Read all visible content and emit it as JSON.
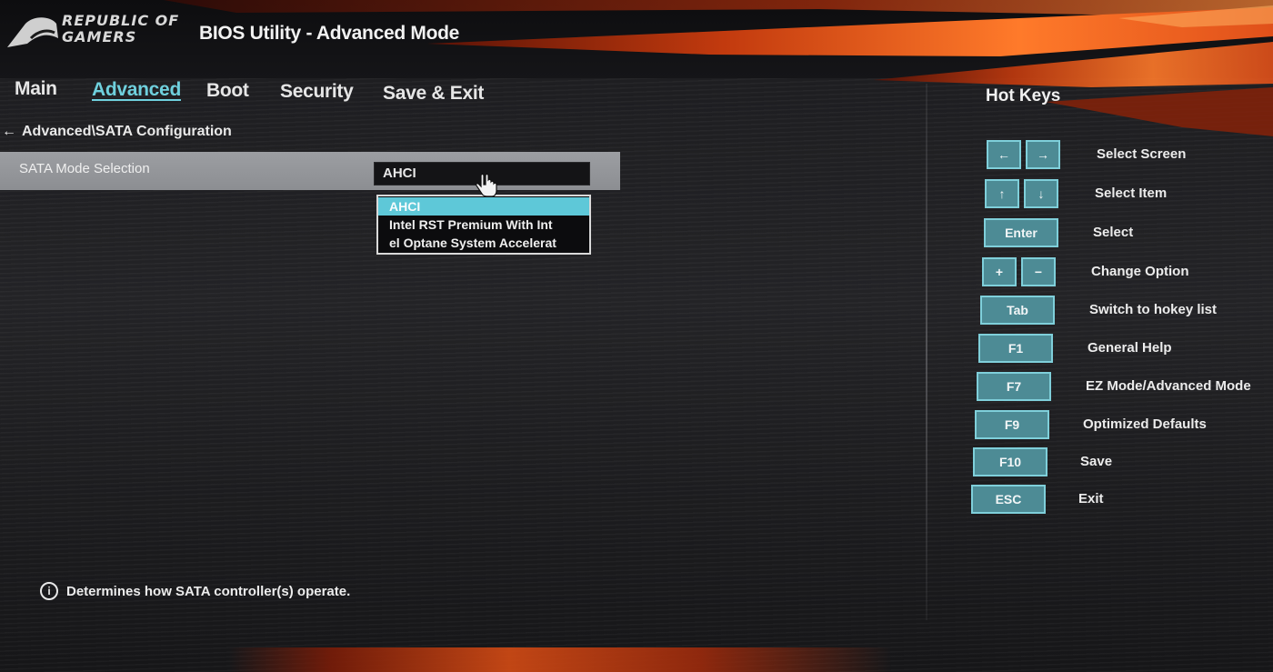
{
  "app": {
    "brand_line1": "REPUBLIC OF",
    "brand_line2": "GAMERS",
    "title": "BIOS Utility - Advanced Mode"
  },
  "tabs": [
    {
      "label": "Main",
      "active": false
    },
    {
      "label": "Advanced",
      "active": true
    },
    {
      "label": "Boot",
      "active": false
    },
    {
      "label": "Security",
      "active": false
    },
    {
      "label": "Save & Exit",
      "active": false
    }
  ],
  "breadcrumb": {
    "back_icon": "back-arrow-icon",
    "text": "Advanced\\SATA Configuration"
  },
  "setting": {
    "label": "SATA Mode Selection",
    "value": "AHCI"
  },
  "dropdown": {
    "options": [
      {
        "label": "AHCI",
        "selected": true
      },
      {
        "label": "Intel RST Premium With Int",
        "selected": false
      },
      {
        "label": "el Optane System Accelerat",
        "selected": false
      }
    ]
  },
  "hotkeys": {
    "title": "Hot Keys",
    "items": [
      {
        "keys": [
          "←",
          "→"
        ],
        "label": "Select Screen"
      },
      {
        "keys": [
          "↑",
          "↓"
        ],
        "label": "Select Item"
      },
      {
        "keys": [
          "Enter"
        ],
        "label": "Select"
      },
      {
        "keys": [
          "+",
          "−"
        ],
        "label": "Change Option"
      },
      {
        "keys": [
          "Tab"
        ],
        "label": "Switch to hokey list"
      },
      {
        "keys": [
          "F1"
        ],
        "label": "General Help"
      },
      {
        "keys": [
          "F7"
        ],
        "label": "EZ Mode/Advanced Mode"
      },
      {
        "keys": [
          "F9"
        ],
        "label": "Optimized Defaults"
      },
      {
        "keys": [
          "F10"
        ],
        "label": "Save"
      },
      {
        "keys": [
          "ESC"
        ],
        "label": "Exit"
      }
    ]
  },
  "help": {
    "icon": "info-icon",
    "icon_glyph": "i",
    "text": "Determines how SATA controller(s) operate."
  },
  "colors": {
    "accent": "#6fd0dd",
    "key_fill": "#4d8b95",
    "brand_orange": "#e0501a"
  }
}
